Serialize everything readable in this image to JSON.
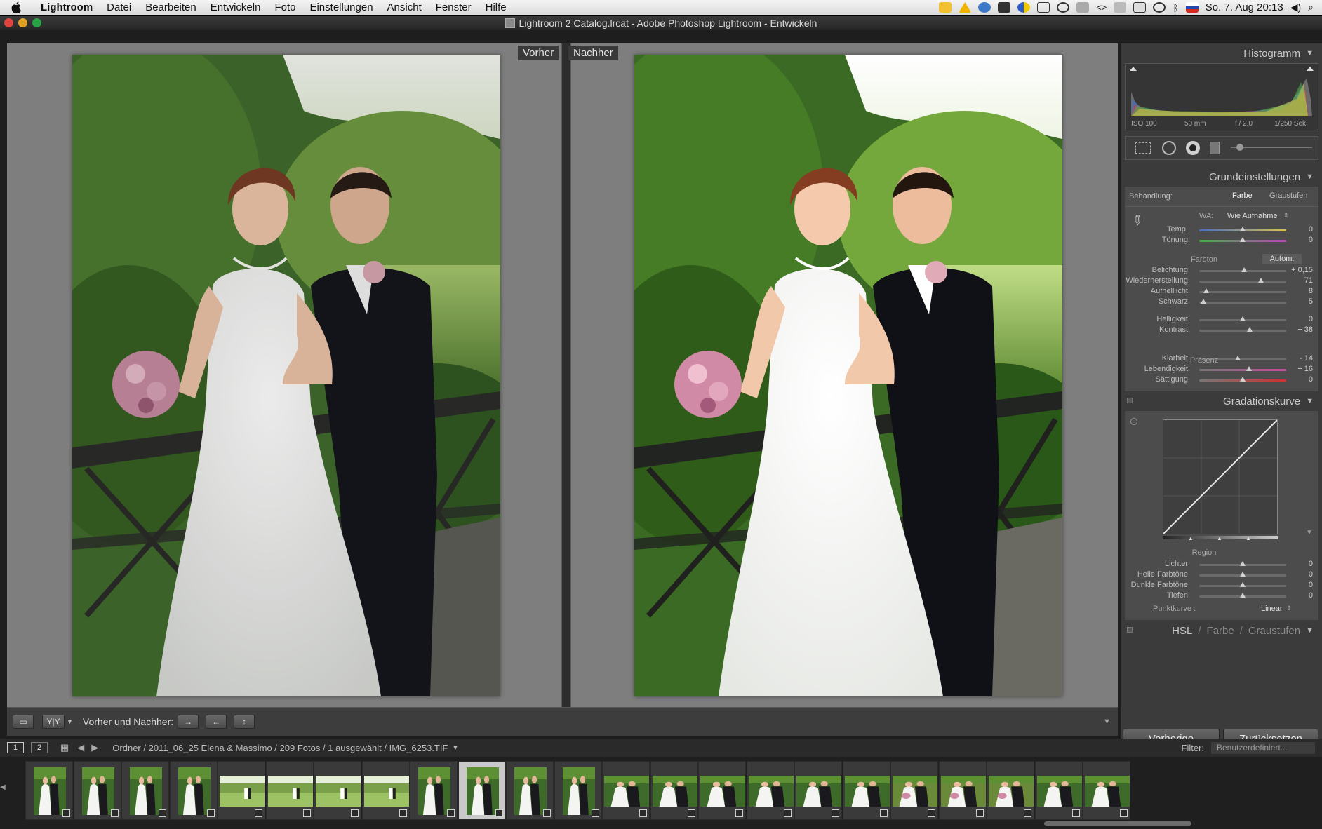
{
  "menubar": {
    "app": "Lightroom",
    "items": [
      "Datei",
      "Bearbeiten",
      "Entwickeln",
      "Foto",
      "Einstellungen",
      "Ansicht",
      "Fenster",
      "Hilfe"
    ],
    "clock": "So. 7. Aug  20:13"
  },
  "window": {
    "title": "Lightroom 2 Catalog.lrcat - Adobe Photoshop Lightroom - Entwickeln"
  },
  "main": {
    "before_label": "Vorher",
    "after_label": "Nachher"
  },
  "toolbar": {
    "view_label": "Vorher und Nachher:"
  },
  "panel": {
    "histogram": {
      "title": "Histogramm",
      "iso": "ISO 100",
      "focal": "50 mm",
      "aperture": "f / 2,0",
      "shutter": "1/250 Sek."
    },
    "basic": {
      "title": "Grundeinstellungen",
      "treatment_label": "Behandlung:",
      "treatment_color": "Farbe",
      "treatment_gray": "Graustufen",
      "wb_label": "WA:",
      "wb_value": "Wie Aufnahme",
      "tone_group": "Farbton",
      "auto": "Autom.",
      "presence_group": "Präsenz",
      "sliders": [
        {
          "label": "Temp.",
          "value": "0",
          "pos": 0.5
        },
        {
          "label": "Tönung",
          "value": "0",
          "pos": 0.5
        },
        {
          "label": "Belichtung",
          "value": "+ 0,15",
          "pos": 0.52
        },
        {
          "label": "Wiederherstellung",
          "value": "71",
          "pos": 0.71
        },
        {
          "label": "Aufhelllicht",
          "value": "8",
          "pos": 0.08
        },
        {
          "label": "Schwarz",
          "value": "5",
          "pos": 0.05
        },
        {
          "label": "Helligkeit",
          "value": "0",
          "pos": 0.5
        },
        {
          "label": "Kontrast",
          "value": "+ 38",
          "pos": 0.58
        },
        {
          "label": "Klarheit",
          "value": "- 14",
          "pos": 0.44
        },
        {
          "label": "Lebendigkeit",
          "value": "+ 16",
          "pos": 0.57
        },
        {
          "label": "Sättigung",
          "value": "0",
          "pos": 0.5
        }
      ]
    },
    "curve": {
      "title": "Gradationskurve",
      "region_group": "Region",
      "point_label": "Punktkurve :",
      "point_value": "Linear",
      "sliders": [
        {
          "label": "Lichter",
          "value": "0",
          "pos": 0.5
        },
        {
          "label": "Helle Farbtöne",
          "value": "0",
          "pos": 0.5
        },
        {
          "label": "Dunkle Farbtöne",
          "value": "0",
          "pos": 0.5
        },
        {
          "label": "Tiefen",
          "value": "0",
          "pos": 0.5
        }
      ]
    },
    "hsl": {
      "hsl": "HSL",
      "farbe": "Farbe",
      "graustufen": "Graustufen"
    },
    "prev_button": "Vorherige",
    "reset_button": "Zurücksetzen"
  },
  "filmstrip": {
    "page1": "1",
    "page2": "2",
    "path": "Ordner / 2011_06_25 Elena & Massimo / 209 Fotos / 1 ausgewählt / IMG_6253.TIF",
    "filter_label": "Filter:",
    "filter_value": "Benutzerdefiniert...",
    "thumbs": [
      {
        "type": "portrait",
        "tone": "couple"
      },
      {
        "type": "portrait",
        "tone": "couple"
      },
      {
        "type": "portrait",
        "tone": "couple"
      },
      {
        "type": "portrait",
        "tone": "couple"
      },
      {
        "type": "landscape",
        "tone": "park"
      },
      {
        "type": "landscape",
        "tone": "park"
      },
      {
        "type": "landscape",
        "tone": "park"
      },
      {
        "type": "landscape",
        "tone": "park"
      },
      {
        "type": "portrait",
        "tone": "couple"
      },
      {
        "type": "portrait",
        "tone": "couple",
        "selected": true
      },
      {
        "type": "portrait",
        "tone": "couple"
      },
      {
        "type": "portrait",
        "tone": "couple"
      },
      {
        "type": "landscape",
        "tone": "couple"
      },
      {
        "type": "landscape",
        "tone": "couple"
      },
      {
        "type": "landscape",
        "tone": "couple"
      },
      {
        "type": "landscape",
        "tone": "couple"
      },
      {
        "type": "landscape",
        "tone": "couple"
      },
      {
        "type": "landscape",
        "tone": "couple"
      },
      {
        "type": "landscape",
        "tone": "bouquet"
      },
      {
        "type": "landscape",
        "tone": "bouquet"
      },
      {
        "type": "landscape",
        "tone": "bouquet"
      },
      {
        "type": "landscape",
        "tone": "couple"
      },
      {
        "type": "landscape",
        "tone": "couple"
      }
    ]
  }
}
